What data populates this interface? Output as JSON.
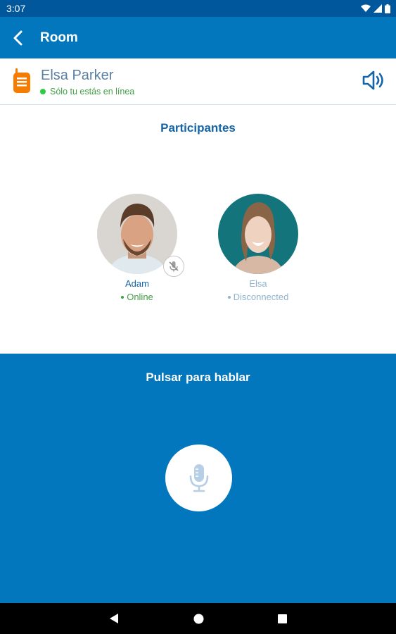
{
  "status_bar": {
    "time": "3:07",
    "icons": [
      "wifi-icon",
      "signal-icon",
      "battery-icon"
    ]
  },
  "app_bar": {
    "title": "Room",
    "back_icon": "back-arrow-icon"
  },
  "header": {
    "contact_name": "Elsa Parker",
    "status_text": "Sólo tu estás en línea",
    "left_icon": "walkie-talkie-icon",
    "right_icon": "speaker-icon"
  },
  "participants_title": "Participantes",
  "participants": [
    {
      "name": "Adam",
      "status": "Online",
      "status_color": "#43a047",
      "muted": true
    },
    {
      "name": "Elsa",
      "status": "Disconnected",
      "status_color": "#90b4d0",
      "muted": false
    }
  ],
  "push_to_talk": {
    "label": "Pulsar para hablar",
    "icon": "microphone-icon"
  },
  "nav_bar": {
    "icons": [
      "nav-back-icon",
      "nav-home-icon",
      "nav-recents-icon"
    ]
  },
  "colors": {
    "primary": "#0277bd",
    "primary_dark": "#01579b",
    "title_blue": "#1465a8",
    "name_gray_blue": "#5a7fa3",
    "online_green": "#43a047",
    "accent_orange": "#f57c00"
  }
}
